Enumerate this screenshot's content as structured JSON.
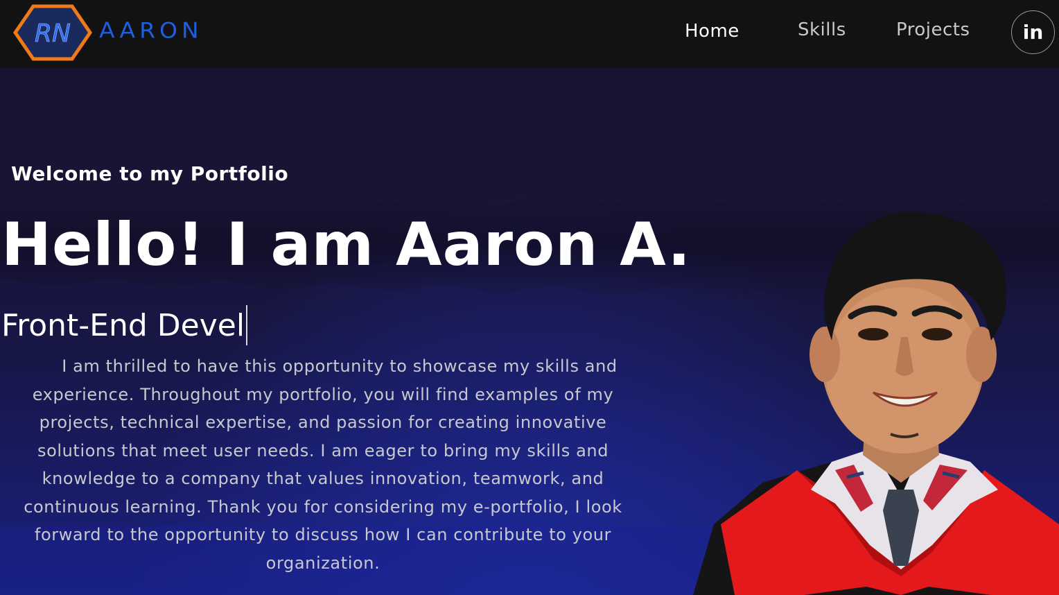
{
  "header": {
    "brand": "AARON",
    "logo_text": "RN",
    "nav": [
      {
        "label": "Home",
        "active": true
      },
      {
        "label": "Skills",
        "active": false
      },
      {
        "label": "Projects",
        "active": false
      }
    ],
    "social_icon": "linkedin-icon",
    "social_label": "in"
  },
  "hero": {
    "welcome": "Welcome to my Portfolio",
    "headline": "Hello! I am Aaron A.",
    "typed_role": "Front-End Devel",
    "intro": "I am thrilled to have this opportunity to showcase my skills and experience. Throughout my portfolio, you will find examples of my projects, technical expertise, and passion for creating innovative solutions that meet user needs. I am eager to bring my skills and knowledge to a company that values innovation, teamwork, and continuous learning. Thank you for considering my e-portfolio, I look forward to the opportunity to discuss how I can contribute to your organization."
  },
  "colors": {
    "navbar_bg": "#121212",
    "brand_blue": "#1e5fe0",
    "logo_orange": "#f07a1a",
    "hero_dark": "#1a1233",
    "hero_blue": "#1a2080",
    "text_white": "#ffffff",
    "text_muted": "#c8c8cf"
  }
}
